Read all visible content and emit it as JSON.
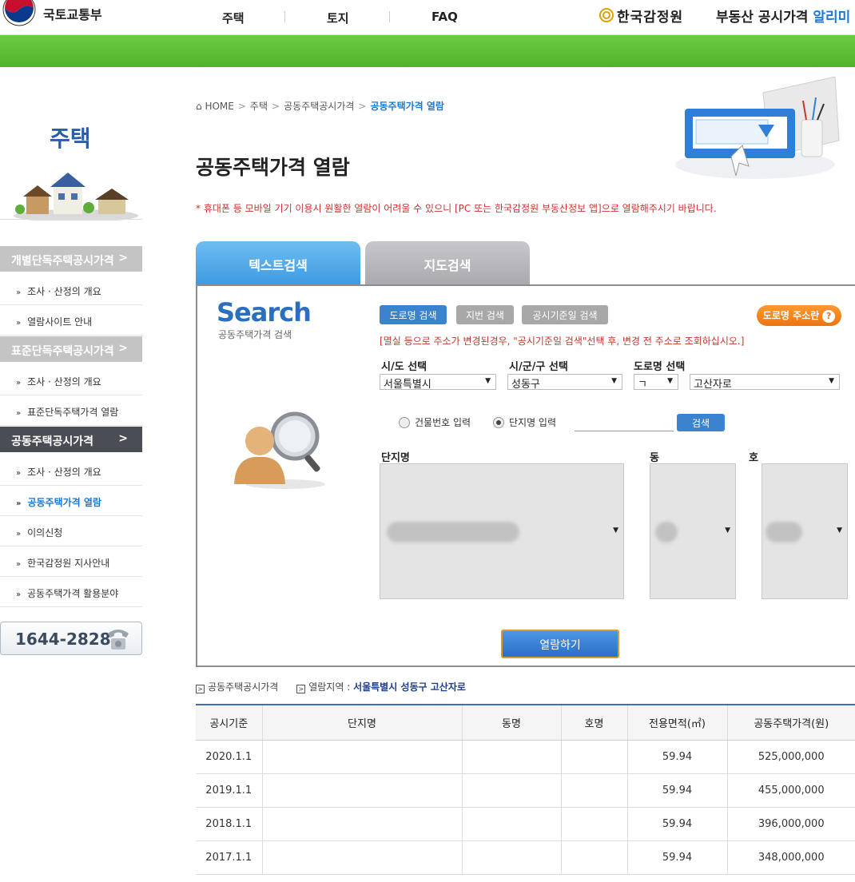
{
  "header": {
    "ministry": "국토교통부",
    "nav": [
      "주택",
      "토지",
      "FAQ"
    ],
    "agency": "한국감정원",
    "site_title": "부동산 공시가격",
    "site_title_accent": "알리미"
  },
  "sidebar": {
    "title": "주택",
    "categories": [
      {
        "label": "개별단독주택공시가격",
        "arrow": ">"
      },
      {
        "label": "표준단독주택공시가격",
        "arrow": ">"
      },
      {
        "label": "공동주택공시가격",
        "arrow": ">"
      }
    ],
    "items": [
      {
        "label": "조사 · 산정의 개요"
      },
      {
        "label": "열람사이트 안내"
      },
      {
        "label": "조사 · 산정의 개요"
      },
      {
        "label": "표준단독주택가격 열람"
      },
      {
        "label": "조사 · 산정의 개요"
      },
      {
        "label": "공동주택가격 열람"
      },
      {
        "label": "이의신청"
      },
      {
        "label": "한국감정원 지사안내"
      },
      {
        "label": "공동주택가격 활용분야"
      }
    ],
    "phone": "1644-2828"
  },
  "breadcrumb": [
    "HOME",
    "주택",
    "공동주택공시가격",
    "공동주택가격 열람"
  ],
  "page_title": "공동주택가격 열람",
  "notice": "* 휴대폰 등 모바일 기기 이용시 원활한 열람이 어려울 수 있으니 [PC 또는 한국감정원 부동산정보 앱]으로 열람해주시기 바랍니다.",
  "tabs": [
    "텍스트검색",
    "지도검색"
  ],
  "search": {
    "logo": "Search",
    "subtitle": "공동주택가격 검색",
    "mode_buttons": [
      "도로명 검색",
      "지번 검색",
      "공시기준일 검색"
    ],
    "help_button": "도로명 주소란",
    "help_icon": "?",
    "warning": "[멸실 등으로 주소가 변경된경우, \"공시기준일 검색\"선택 후, 변경 전 주소로 조회하십시오.]",
    "sido_label": "시/도 선택",
    "sido_value": "서울특별시",
    "sigungu_label": "시/군/구 선택",
    "sigungu_value": "성동구",
    "road_label": "도로명 선택",
    "road_initial": "ㄱ",
    "road_value": "고산자로",
    "radio_building": "건물번호 입력",
    "radio_complex": "단지명 입력",
    "find_button": "검색",
    "col_complex": "단지명",
    "col_dong": "동",
    "col_ho": "호",
    "view_button": "열람하기"
  },
  "result_info": {
    "label1": "공동주택공시가격",
    "label2": "열람지역 : ",
    "area": "서울특별시 성동구 고산자로"
  },
  "table": {
    "headers": [
      "공시기준",
      "단지명",
      "동명",
      "호명",
      "전용면적(㎡)",
      "공동주택가격(원)"
    ],
    "rows": [
      [
        "2020.1.1",
        "",
        "",
        "",
        "59.94",
        "525,000,000"
      ],
      [
        "2019.1.1",
        "",
        "",
        "",
        "59.94",
        "455,000,000"
      ],
      [
        "2018.1.1",
        "",
        "",
        "",
        "59.94",
        "396,000,000"
      ],
      [
        "2017.1.1",
        "",
        "",
        "",
        "59.94",
        "348,000,000"
      ]
    ]
  }
}
